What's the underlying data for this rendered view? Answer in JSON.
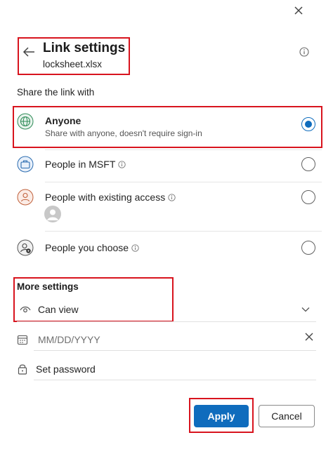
{
  "header": {
    "title": "Link settings",
    "filename": "locksheet.xlsx"
  },
  "share_section": {
    "label": "Share the link with",
    "options": [
      {
        "title": "Anyone",
        "subtitle": "Share with anyone, doesn't require sign-in",
        "icon": "globe-icon",
        "selected": true
      },
      {
        "title": "People in MSFT",
        "icon": "briefcase-icon",
        "selected": false
      },
      {
        "title": "People with existing access",
        "icon": "person-icon",
        "selected": false
      },
      {
        "title": "People you choose",
        "icon": "person-settings-icon",
        "selected": false
      }
    ]
  },
  "more_settings": {
    "label": "More settings",
    "permission": "Can view",
    "date_placeholder": "MM/DD/YYYY",
    "password_label": "Set password"
  },
  "buttons": {
    "apply": "Apply",
    "cancel": "Cancel"
  },
  "colors": {
    "accent": "#0f6cbd",
    "highlight_box": "#d8141e",
    "globe": "#2e8b57",
    "briefcase": "#2b6cb0",
    "person": "#c0603a"
  }
}
